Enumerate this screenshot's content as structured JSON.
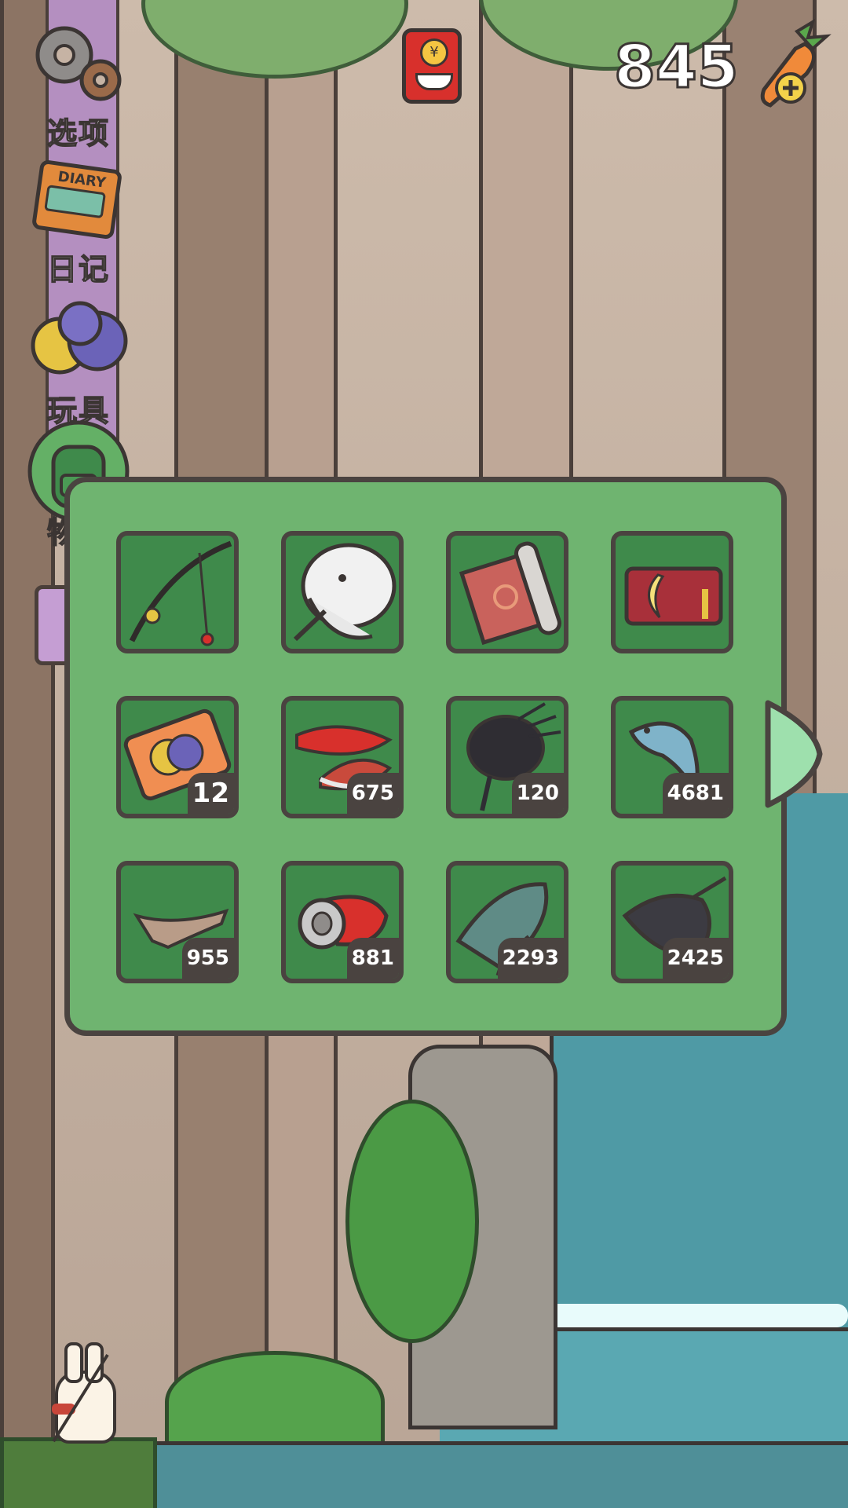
{
  "hud": {
    "carrot_count": "845",
    "red_envelope_icon": "red-envelope-icon",
    "add_carrot_icon": "carrot-plus-icon"
  },
  "menu": {
    "options_label": "选项",
    "diary_label": "日记",
    "toys_label": "玩具",
    "items_label": "物品",
    "diary_cover_text": "DIARY"
  },
  "inventory": {
    "items": [
      {
        "icon": "fishing-rod-icon",
        "count": ""
      },
      {
        "icon": "whale-fish-icon",
        "count": ""
      },
      {
        "icon": "scroll-mat-icon",
        "count": ""
      },
      {
        "icon": "calendar-card-icon",
        "count": ""
      },
      {
        "icon": "toy-ticket-icon",
        "count": "12"
      },
      {
        "icon": "red-salmon-icon",
        "count": "675"
      },
      {
        "icon": "black-spiny-fish-icon",
        "count": "120"
      },
      {
        "icon": "blue-fish-icon",
        "count": "4681"
      },
      {
        "icon": "driftwood-icon",
        "count": "955"
      },
      {
        "icon": "crushed-can-icon",
        "count": "881"
      },
      {
        "icon": "lizard-fish-icon",
        "count": "2293"
      },
      {
        "icon": "stingray-icon",
        "count": "2425"
      }
    ]
  },
  "colors": {
    "panel": "#6fb470",
    "slot": "#3f8a4b",
    "outline": "#4a4340",
    "menu_strip": "#b48fc0"
  }
}
